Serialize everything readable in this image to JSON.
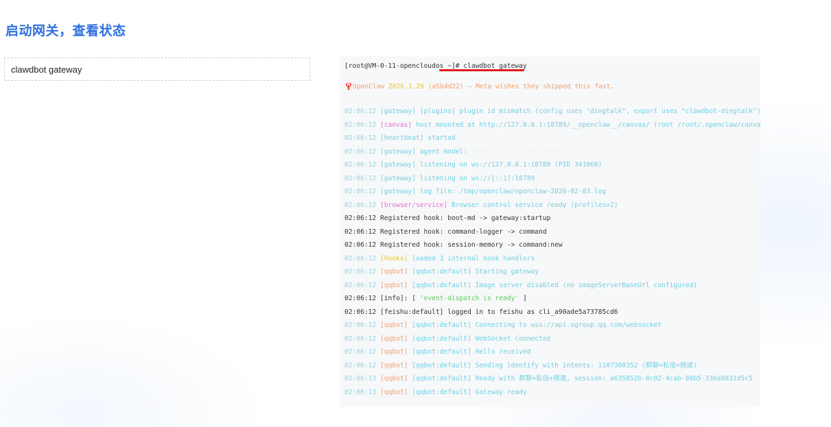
{
  "section_title": "启动网关，查看状态",
  "command_box": "clawdbot gateway",
  "terminal": {
    "prompt": "[root@VM-0-11-opencloudos ~]# ",
    "command": "clawdbot  gateway",
    "banner": {
      "icon": "🦞",
      "app": "OpenClaw",
      "version": "2026.1.29",
      "build": "(a5b4d22)",
      "tagline": "— Meta wishes they shipped this fast."
    },
    "logs": [
      {
        "time": "02:06:12",
        "tag": "[gateway]",
        "tag_color": "cyan",
        "msg": "[plugins] plugin id mismatch (config uses \"dingtalk\", export uses \"clawdbot-dingtalk\") (plug",
        "msg_color": "cyan"
      },
      {
        "time": "02:06:12",
        "tag": "[canvas]",
        "tag_color": "magenta",
        "msg": "host mounted at http://127.0.0.1:18789/__openclaw__/canvas/ (root /root/.openclaw/canvas)",
        "msg_color": "cyan"
      },
      {
        "time": "02:06:12",
        "tag": "[heartbeat]",
        "tag_color": "cyan",
        "msg": "started",
        "msg_color": "cyan"
      },
      {
        "time": "02:06:12",
        "tag": "[gateway]",
        "tag_color": "cyan",
        "msg": "agent model:",
        "msg_color": "cyan",
        "extra": "qwen-portal/coder-model",
        "extra_color": "white"
      },
      {
        "time": "02:06:12",
        "tag": "[gateway]",
        "tag_color": "cyan",
        "msg": "listening on ws://127.0.0.1:18789 (PID 341068)",
        "msg_color": "cyan"
      },
      {
        "time": "02:06:12",
        "tag": "[gateway]",
        "tag_color": "cyan",
        "msg": "listening on ws://[::1]:18789",
        "msg_color": "cyan"
      },
      {
        "time": "02:06:12",
        "tag": "[gateway]",
        "tag_color": "cyan",
        "msg": "log file: /tmp/openclaw/openclaw-2026-02-03.log",
        "msg_color": "cyan"
      },
      {
        "time": "02:06:12",
        "tag": "[browser/service]",
        "tag_color": "magenta",
        "msg": "Browser control service ready (profiles=2)",
        "msg_color": "cyan"
      },
      {
        "time": "02:06:12",
        "tag": "",
        "tag_color": "dark",
        "msg": "Registered hook: boot-md -> gateway:startup",
        "msg_color": "dark",
        "ts_dark": true
      },
      {
        "time": "02:06:12",
        "tag": "",
        "tag_color": "dark",
        "msg": "Registered hook: command-logger -> command",
        "msg_color": "dark",
        "ts_dark": true
      },
      {
        "time": "02:06:12",
        "tag": "",
        "tag_color": "dark",
        "msg": "Registered hook: session-memory -> command:new",
        "msg_color": "dark",
        "ts_dark": true
      },
      {
        "time": "02:06:12",
        "tag": "[hooks]",
        "tag_color": "yellow",
        "msg": "loaded 3 internal hook handlers",
        "msg_color": "cyan"
      },
      {
        "time": "02:06:12",
        "tag": "[qqbot]",
        "tag_color": "orange",
        "msg": "[qqbot:default] Starting gateway",
        "msg_color": "cyan"
      },
      {
        "time": "02:06:12",
        "tag": "[qqbot]",
        "tag_color": "orange",
        "msg": "[qqbot:default] Image server disabled (no imageServerBaseUrl configured)",
        "msg_color": "cyan"
      },
      {
        "time": "02:06:12",
        "tag": "[info]: [",
        "tag_color": "dark",
        "msg": "'event-dispatch is ready'",
        "msg_color": "green",
        "suffix": " ]",
        "ts_dark": true
      },
      {
        "time": "02:06:12",
        "tag": "[feishu:default]",
        "tag_color": "dark",
        "msg": "logged in to feishu as cli_a90ade5a73785cd6",
        "msg_color": "dark",
        "ts_dark": true
      },
      {
        "time": "02:06:12",
        "tag": "[qqbot]",
        "tag_color": "orange",
        "msg": "[qqbot:default] Connecting to wss://api.sgroup.qq.com/websocket",
        "msg_color": "cyan"
      },
      {
        "time": "02:06:12",
        "tag": "[qqbot]",
        "tag_color": "orange",
        "msg": "[qqbot:default] WebSocket connected",
        "msg_color": "cyan"
      },
      {
        "time": "02:06:12",
        "tag": "[qqbot]",
        "tag_color": "orange",
        "msg": "[qqbot:default] Hello received",
        "msg_color": "cyan"
      },
      {
        "time": "02:06:12",
        "tag": "[qqbot]",
        "tag_color": "orange",
        "msg": "[qqbot:default] Sending identify with intents: 1107300352 (群聊+私信+频道)",
        "msg_color": "cyan"
      },
      {
        "time": "02:06:13",
        "tag": "[qqbot]",
        "tag_color": "orange",
        "msg": "[qqbot:default] Ready with 群聊+私信+频道, session: a635852b-0c02-4cab-98b5-336a8831d5c5",
        "msg_color": "cyan"
      },
      {
        "time": "02:06:13",
        "tag": "[qqbot]",
        "tag_color": "orange",
        "msg": "[qqbot:default] Gateway ready",
        "msg_color": "cyan"
      }
    ]
  }
}
